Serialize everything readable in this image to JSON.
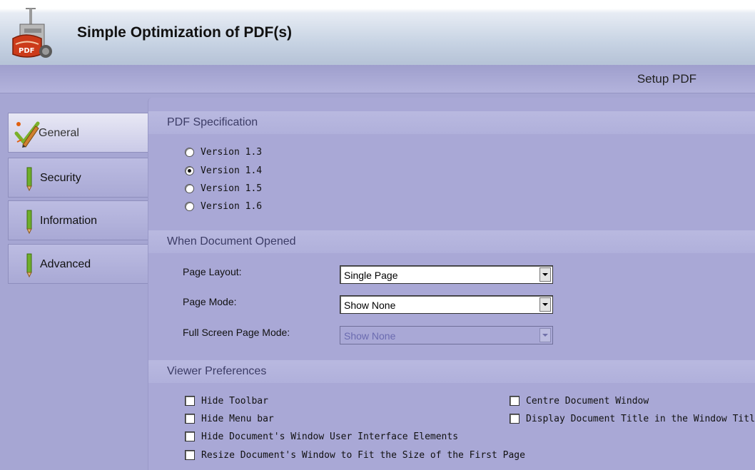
{
  "app": {
    "title": "Simple Optimization of PDF(s)",
    "logo_text": "PDF"
  },
  "setup_title": "Setup PDF",
  "tabs": [
    {
      "label": "General",
      "active": true
    },
    {
      "label": "Security",
      "active": false
    },
    {
      "label": "Information",
      "active": false
    },
    {
      "label": "Advanced",
      "active": false
    }
  ],
  "pdf_spec": {
    "title": "PDF Specification",
    "options": [
      "Version 1.3",
      "Version 1.4",
      "Version 1.5",
      "Version 1.6"
    ],
    "selected": "Version 1.4"
  },
  "doc_opened": {
    "title": "When Document Opened",
    "page_layout": {
      "label": "Page Layout:",
      "value": "Single Page"
    },
    "page_mode": {
      "label": "Page Mode:",
      "value": "Show None"
    },
    "full_screen_mode": {
      "label": "Full Screen Page Mode:",
      "value": "Show None",
      "disabled": true
    }
  },
  "viewer_prefs": {
    "title": "Viewer Preferences",
    "options": [
      "Hide Toolbar",
      "Hide Menu bar",
      "Hide Document's Window User Interface Elements",
      "Resize Document's Window to Fit the Size of the First Page",
      "Centre Document Window",
      "Display Document Title in the Window Title bar"
    ]
  },
  "colors": {
    "panel_bg": "#a9a8d6",
    "section_header": "#b9b9e0",
    "section_text": "#3c3c66"
  }
}
